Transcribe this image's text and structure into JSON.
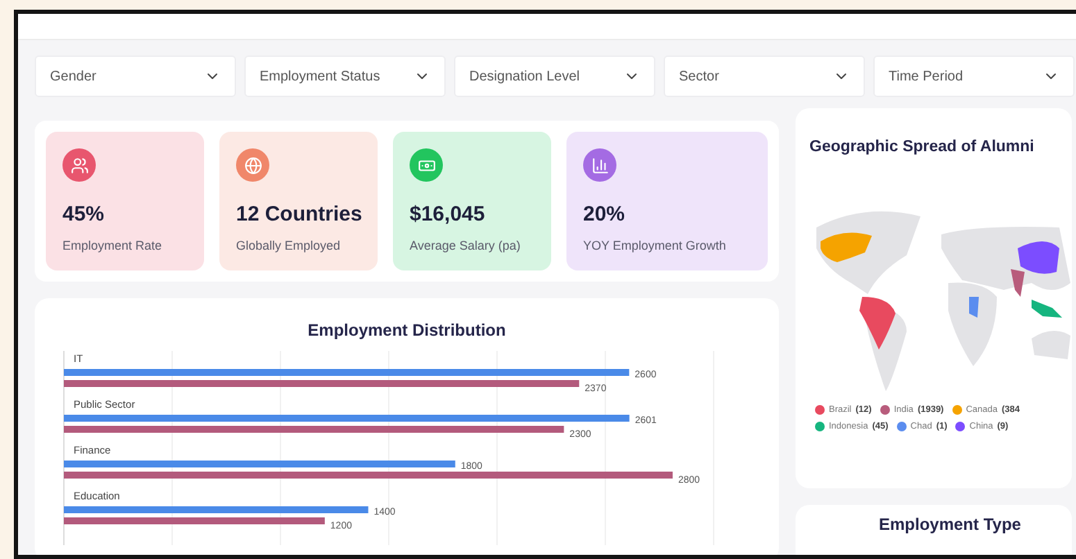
{
  "filters": [
    {
      "label": "Gender"
    },
    {
      "label": "Employment Status"
    },
    {
      "label": "Designation Level"
    },
    {
      "label": "Sector"
    },
    {
      "label": "Time Period"
    }
  ],
  "kpis": [
    {
      "kind": "people",
      "value": "45%",
      "label": "Employment Rate",
      "color": "#e8566e"
    },
    {
      "kind": "globe",
      "value": "12 Countries",
      "label": "Globally Employed",
      "color": "#f0876a"
    },
    {
      "kind": "money",
      "value": "$16,045",
      "label": "Average Salary (pa)",
      "color": "#22c55e"
    },
    {
      "kind": "chart",
      "value": "20%",
      "label": "YOY Employment Growth",
      "color": "#a46be3"
    }
  ],
  "distribution": {
    "title": "Employment Distribution",
    "chart_data": {
      "type": "bar",
      "orientation": "horizontal",
      "categories": [
        "IT",
        "Public Sector",
        "Finance",
        "Education"
      ],
      "series": [
        {
          "color": "#4a8ae8",
          "values": [
            2600,
            2601,
            1800,
            1400
          ]
        },
        {
          "color": "#b35a7c",
          "values": [
            2370,
            2300,
            2800,
            1200
          ]
        }
      ],
      "data_labels": true
    }
  },
  "geo": {
    "title": "Geographic Spread of Alumni",
    "legend": [
      {
        "label": "Brazil",
        "count": "(12)",
        "color": "#e84a5f"
      },
      {
        "label": "India",
        "count": "(1939)",
        "color": "#b85c7c"
      },
      {
        "label": "Canada",
        "count": "(384",
        "color": "#f5a300"
      },
      {
        "label": "Indonesia",
        "count": "(45)",
        "color": "#16b57f"
      },
      {
        "label": "Chad",
        "count": "(1)",
        "color": "#5b8def"
      },
      {
        "label": "China",
        "count": "(9)",
        "color": "#7c4dff"
      }
    ]
  },
  "employment_type": {
    "title": "Employment Type"
  }
}
